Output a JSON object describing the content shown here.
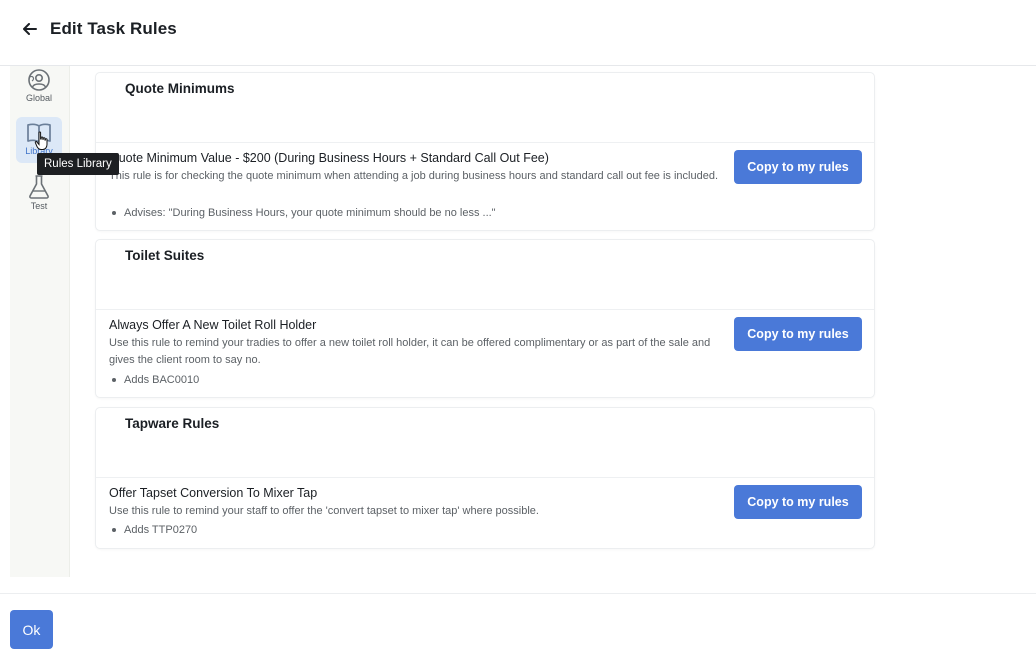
{
  "header": {
    "title": "Edit Task Rules",
    "back_icon": "arrow-left-icon"
  },
  "rail": {
    "items": [
      {
        "label": "Global",
        "icon": "globe-user-icon",
        "active": false
      },
      {
        "label": "Library",
        "icon": "book-open-icon",
        "active": true
      },
      {
        "label": "Test",
        "icon": "flask-icon",
        "active": false
      }
    ],
    "tooltip": "Rules Library"
  },
  "groups": [
    {
      "title": "Quote Minimums",
      "rule": {
        "title": "Quote Minimum Value - $200 (During Business Hours + Standard Call Out Fee)",
        "description": "This rule is for checking the quote minimum when attending a job during business hours and standard call out fee is included.",
        "bullet": "Advises: \"During Business Hours, your quote minimum should be no less ...\"",
        "button": "Copy to my rules"
      }
    },
    {
      "title": "Toilet Suites",
      "rule": {
        "title": "Always Offer A New Toilet Roll Holder",
        "description": "Use this rule to remind your tradies to offer a new toilet roll holder, it can be offered complimentary or as part of the sale and gives the client room to say no.",
        "bullet": "Adds BAC0010",
        "button": "Copy to my rules"
      }
    },
    {
      "title": "Tapware Rules",
      "rule": {
        "title": "Offer Tapset Conversion To Mixer Tap",
        "description": "Use this rule to remind your staff to offer the 'convert tapset to mixer tap' where possible.",
        "bullet": "Adds TTP0270",
        "button": "Copy to my rules"
      }
    }
  ],
  "footer": {
    "ok_label": "Ok"
  },
  "colors": {
    "accent": "#4a79d8",
    "rail_bg": "#f7f8f5",
    "active_rail_bg": "#dce8f7",
    "tooltip_bg": "#1d1f22"
  }
}
